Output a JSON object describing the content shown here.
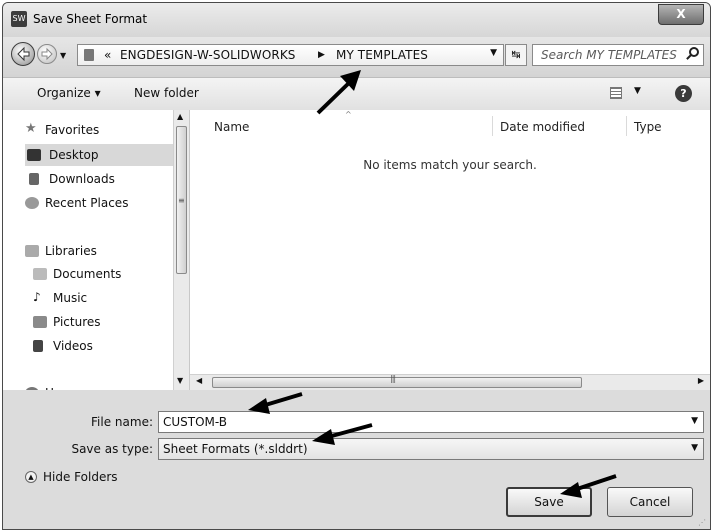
{
  "window": {
    "title": "Save Sheet Format",
    "app_icon": "SW",
    "close_label": "X"
  },
  "address": {
    "separator": "«",
    "crumbs": [
      "ENGDESIGN-W-SOLIDWORKS",
      "MY TEMPLATES"
    ],
    "crumb_arrow": "▶",
    "search_placeholder": "Search MY TEMPLATES"
  },
  "toolbar": {
    "organize": "Organize ▾",
    "new_folder": "New folder"
  },
  "sidebar": {
    "items": [
      {
        "label": "Favorites",
        "icon": "star-icon"
      },
      {
        "label": "Desktop",
        "icon": "desktop-icon"
      },
      {
        "label": "Downloads",
        "icon": "downloads-icon"
      },
      {
        "label": "Recent Places",
        "icon": "recent-places-icon"
      },
      {
        "label": "Libraries",
        "icon": "libraries-icon"
      },
      {
        "label": "Documents",
        "icon": "documents-icon"
      },
      {
        "label": "Music",
        "icon": "music-icon"
      },
      {
        "label": "Pictures",
        "icon": "pictures-icon"
      },
      {
        "label": "Videos",
        "icon": "videos-icon"
      },
      {
        "label": "Homegroup",
        "icon": "homegroup-icon"
      }
    ],
    "selected": "Desktop"
  },
  "columns": [
    "Name",
    "Date modified",
    "Type"
  ],
  "empty_message": "No items match your search.",
  "form": {
    "file_name_label": "File name:",
    "file_name_value": "CUSTOM-B",
    "save_type_label": "Save as type:",
    "save_type_value": "Sheet Formats (*.slddrt)"
  },
  "footer": {
    "hide_folders": "Hide Folders",
    "save": "Save",
    "cancel": "Cancel"
  },
  "colors": {
    "window_bg": "#dcdcdc",
    "selection": "#d8d8d8",
    "annotation_arrow": "#000000"
  }
}
